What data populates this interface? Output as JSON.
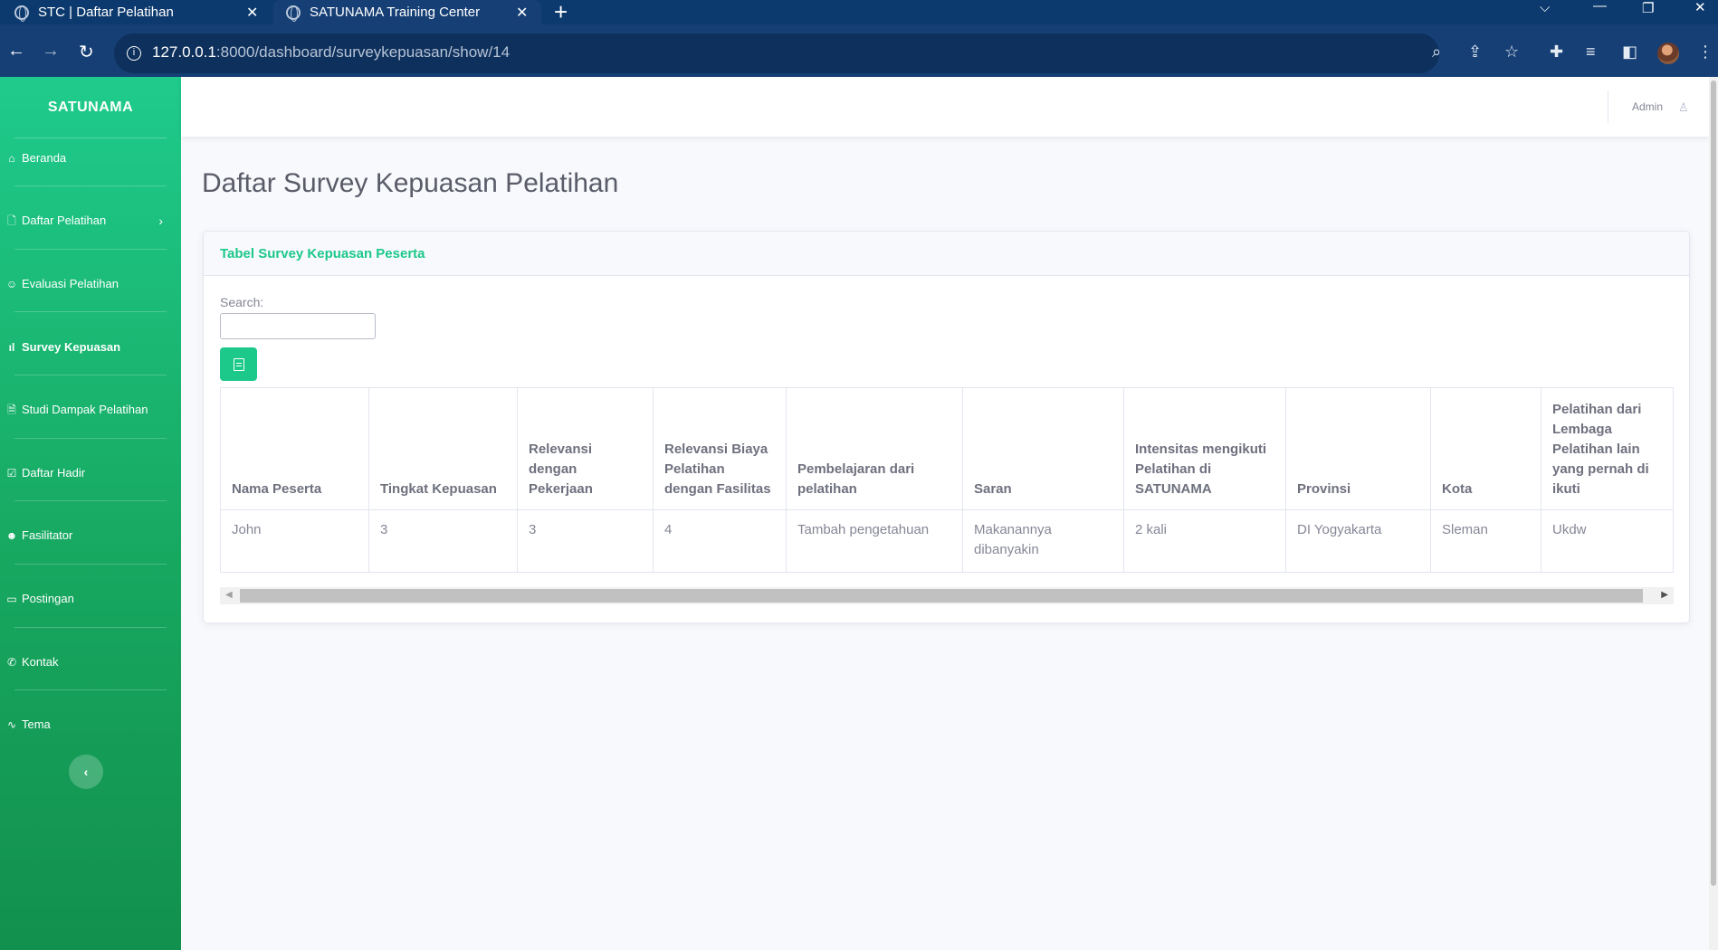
{
  "browser": {
    "tabs": [
      {
        "title": "STC | Daftar Pelatihan"
      },
      {
        "title": "SATUNAMA Training Center"
      }
    ],
    "url_host": "127.0.0.1",
    "url_rest": ":8000/dashboard/surveykepuasan/show/14"
  },
  "sidebar": {
    "brand": "SATUNAMA",
    "items": [
      {
        "label": "Beranda",
        "icon": "home-icon"
      },
      {
        "label": "Daftar Pelatihan",
        "icon": "file-plus-icon"
      },
      {
        "label": "Evaluasi Pelatihan",
        "icon": "user-check-icon"
      },
      {
        "label": "Survey Kepuasan",
        "icon": "bar-chart-icon",
        "active": true
      },
      {
        "label": "Studi Dampak Pelatihan",
        "icon": "file-text-icon"
      },
      {
        "label": "Daftar Hadir",
        "icon": "check-square-icon"
      },
      {
        "label": "Fasilitator",
        "icon": "users-icon"
      },
      {
        "label": "Postingan",
        "icon": "monitor-icon"
      },
      {
        "label": "Kontak",
        "icon": "phone-icon"
      },
      {
        "label": "Tema",
        "icon": "activity-icon"
      }
    ]
  },
  "topbar": {
    "user": "Admin"
  },
  "page": {
    "title": "Daftar Survey Kepuasan Pelatihan",
    "card_title": "Tabel Survey Kepuasan Peserta",
    "search_label": "Search:"
  },
  "table": {
    "headers": [
      "Nama Peserta",
      "Tingkat Kepuasan",
      "Relevansi dengan Pekerjaan",
      "Relevansi Biaya Pelatihan dengan Fasilitas",
      "Pembelajaran dari pelatihan",
      "Saran",
      "Intensitas mengikuti Pelatihan di SATUNAMA",
      "Provinsi",
      "Kota",
      "Pelatihan dari Lembaga Pelatihan lain yang pernah di ikuti"
    ],
    "rows": [
      [
        "John",
        "3",
        "3",
        "4",
        "Tambah pengetahuan",
        "Makanannya dibanyakin",
        "2 kali",
        "DI Yogyakarta",
        "Sleman",
        "Ukdw"
      ]
    ]
  },
  "colors": {
    "primary": "#1cc88a",
    "sidebar_top": "#1fcb8c",
    "sidebar_bottom": "#12904d",
    "browser": "#163f75"
  }
}
